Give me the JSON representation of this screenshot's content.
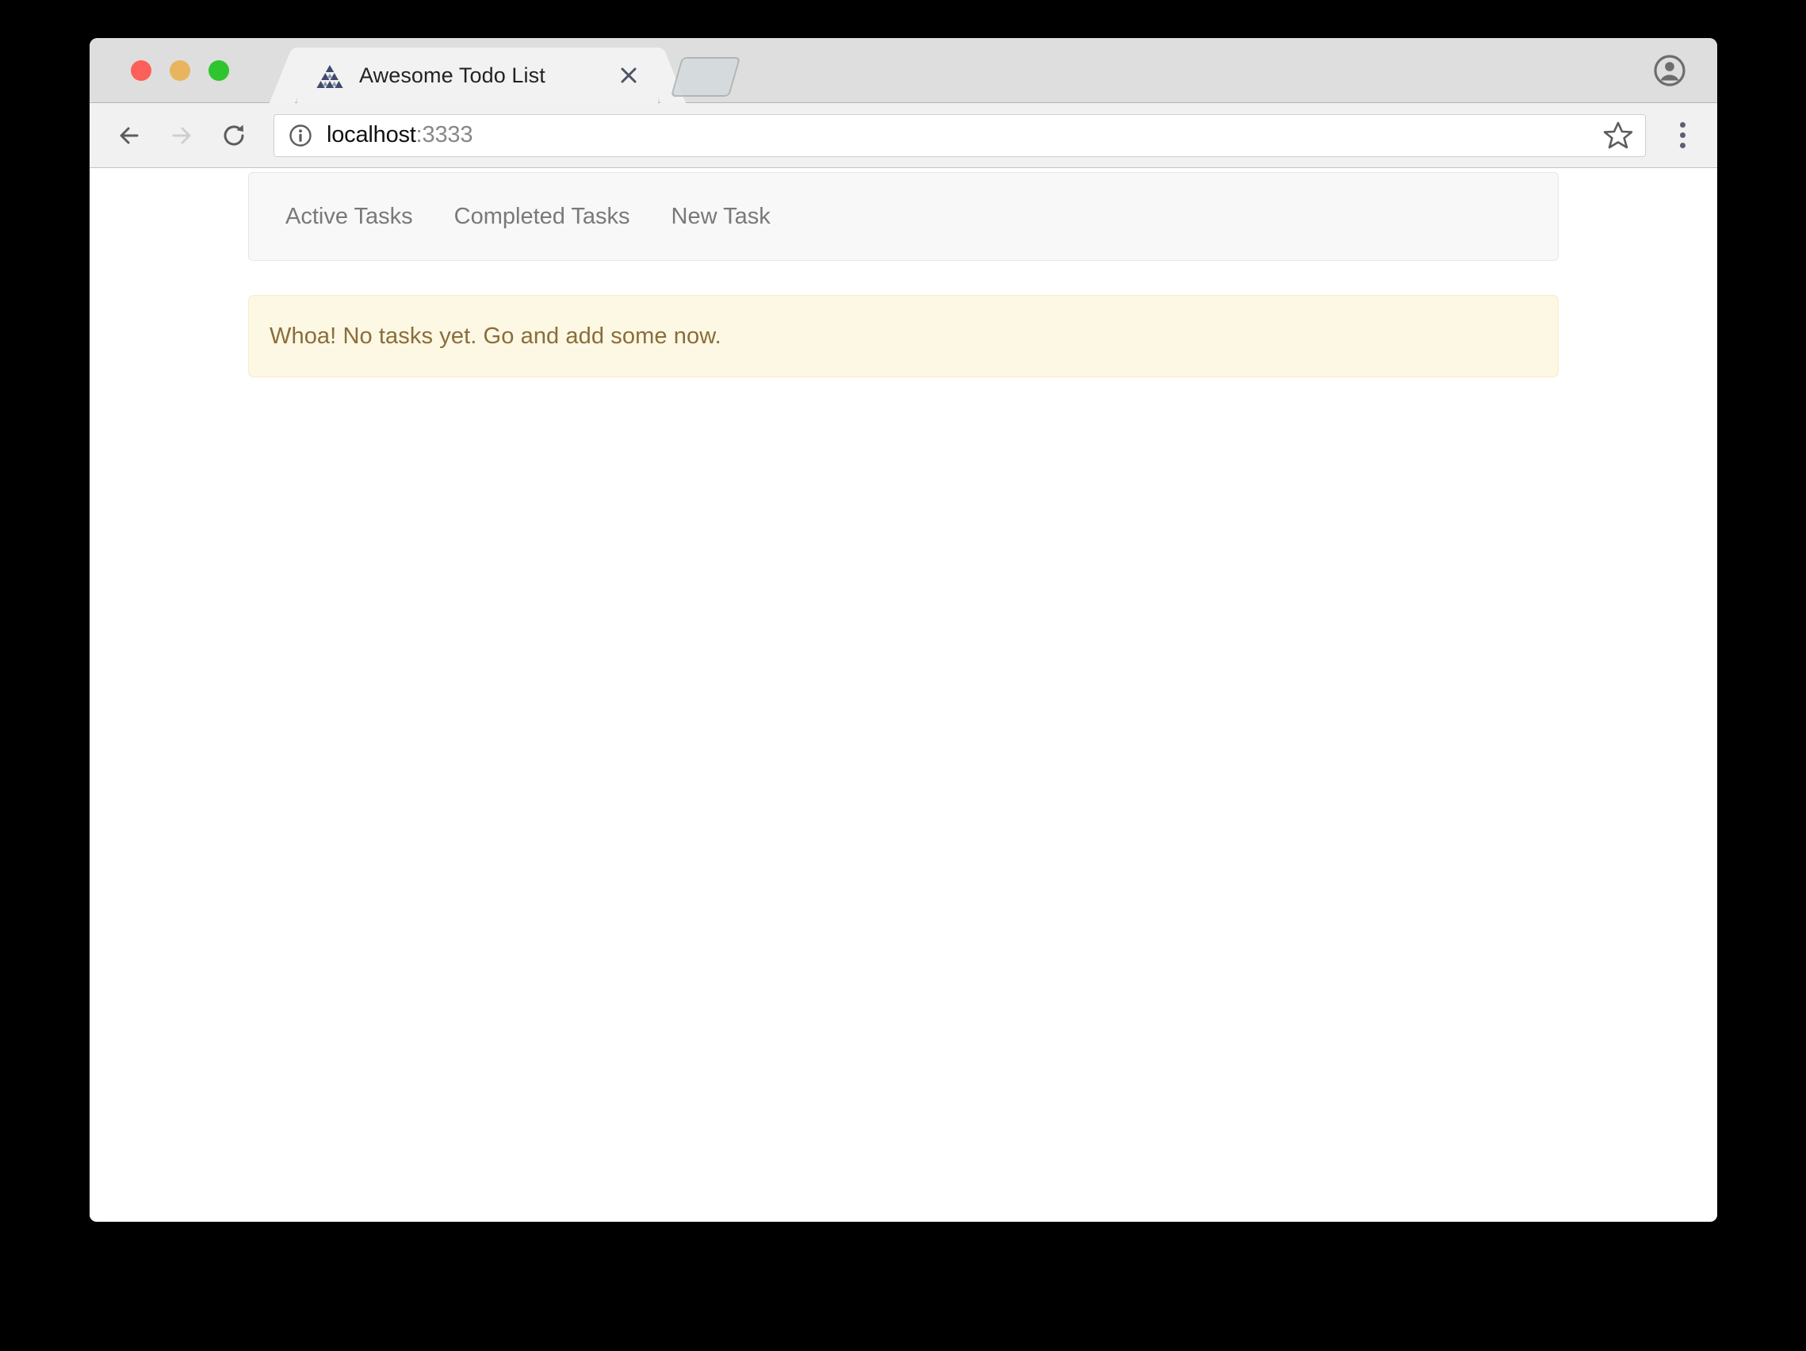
{
  "browser": {
    "window_controls": [
      {
        "name": "close",
        "color": "#fc6058"
      },
      {
        "name": "minimize",
        "color": "#e8b55e"
      },
      {
        "name": "maximize",
        "color": "#2fc52f"
      }
    ],
    "tab": {
      "title": "Awesome Todo List",
      "favicon": "triangle-logo-icon",
      "close_icon": "close-icon"
    },
    "new_tab_icon": "new-tab-icon",
    "profile_icon": "profile-avatar-icon",
    "toolbar": {
      "back_icon": "back-arrow-icon",
      "forward_icon": "forward-arrow-icon",
      "reload_icon": "reload-icon",
      "info_icon": "info-circle-icon",
      "url_host": "localhost",
      "url_port": ":3333",
      "url_full": "localhost:3333",
      "bookmark_icon": "star-icon",
      "menu_icon": "three-dot-menu-icon"
    }
  },
  "page": {
    "navbar": {
      "links": [
        {
          "label": "Active Tasks"
        },
        {
          "label": "Completed Tasks"
        },
        {
          "label": "New Task"
        }
      ]
    },
    "alert": {
      "message": "Whoa! No tasks yet. Go and add some now.",
      "background": "#fcf8e3",
      "border": "#faebcc",
      "text_color": "#8a6d3b"
    }
  }
}
